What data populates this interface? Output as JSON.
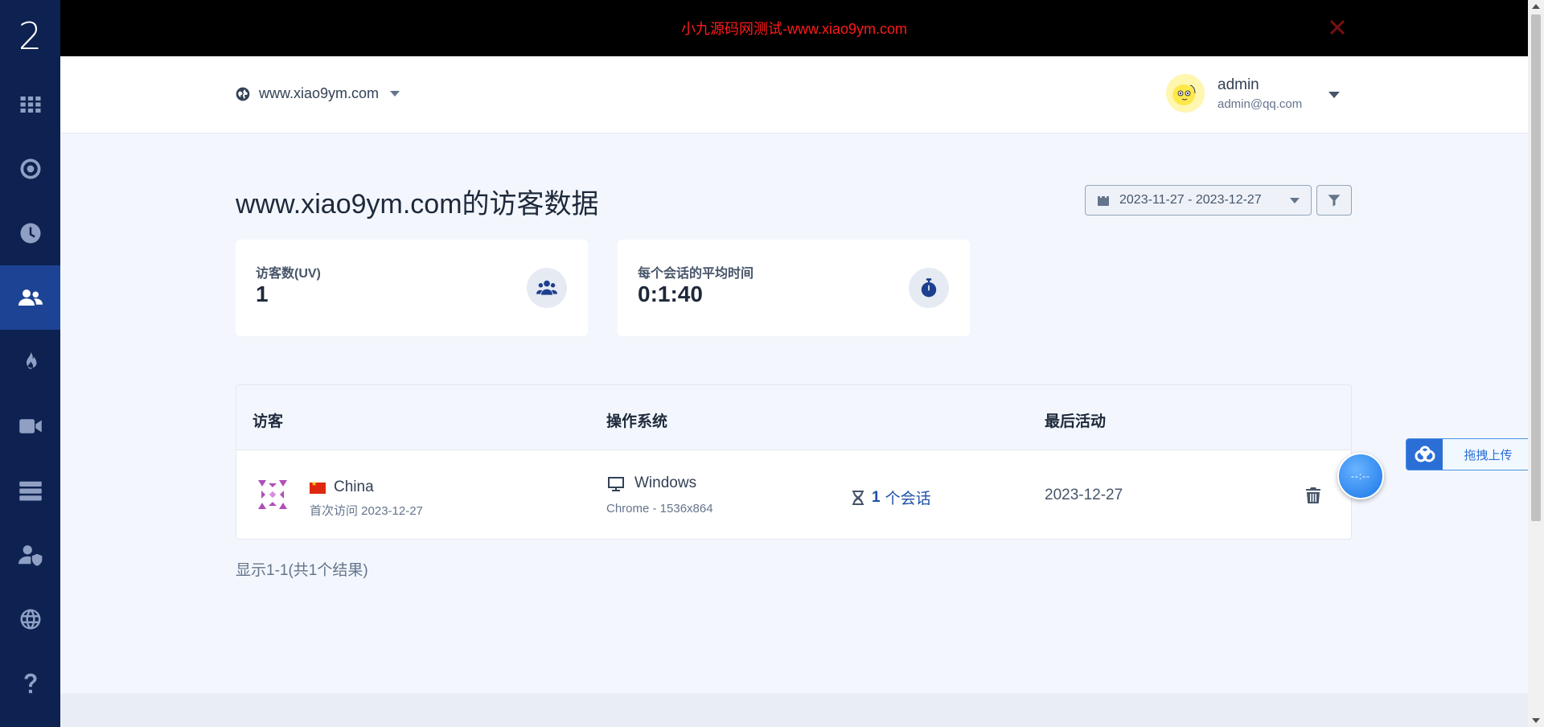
{
  "sidebar": {
    "logo": "2",
    "items": [
      {
        "icon": "grid-icon"
      },
      {
        "icon": "target-icon"
      },
      {
        "icon": "clock-icon"
      },
      {
        "icon": "users-icon",
        "active": true
      },
      {
        "icon": "fire-icon"
      },
      {
        "icon": "video-icon"
      },
      {
        "icon": "server-icon"
      },
      {
        "icon": "user-shield-icon"
      },
      {
        "icon": "globe-icon"
      },
      {
        "icon": "help-icon"
      }
    ]
  },
  "banner": {
    "text": "小九源码网测试-www.xiao9ym.com",
    "text_color": "#ff1a1a"
  },
  "header": {
    "site": "www.xiao9ym.com",
    "user_name": "admin",
    "user_email": "admin@qq.com"
  },
  "main": {
    "title": "www.xiao9ym.com的访客数据",
    "date_range": "2023-11-27 - 2023-12-27",
    "cards": [
      {
        "label": "访客数(UV)",
        "value": "1",
        "icon": "users-icon"
      },
      {
        "label": "每个会话的平均时间",
        "value": "0:1:40",
        "icon": "stopwatch-icon"
      }
    ]
  },
  "table": {
    "headers": {
      "visitor": "访客",
      "os": "操作系统",
      "last_activity": "最后活动"
    },
    "rows": [
      {
        "country": "China",
        "first_visit": "首次访问 2023-12-27",
        "os": "Windows",
        "browser": "Chrome - 1536x864",
        "sessions_count": "1",
        "sessions_label": "个会话",
        "last_active": "2023-12-27"
      }
    ],
    "result_summary": "显示1-1(共1个结果)"
  },
  "widgets": {
    "float_timer": "--:--",
    "upload_label": "拖拽上传"
  },
  "colors": {
    "sidebar": "#0d2250",
    "sidebar_active": "#1d4394",
    "accent": "#1d4fa8"
  }
}
